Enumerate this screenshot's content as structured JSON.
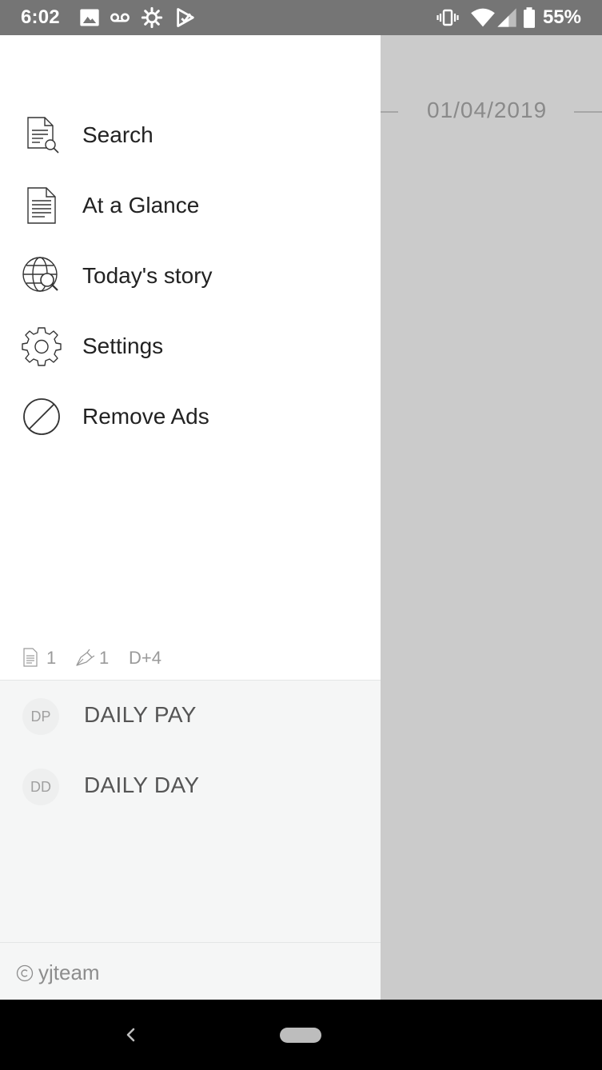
{
  "status_bar": {
    "time": "6:02",
    "battery": "55%"
  },
  "menu": {
    "items": [
      {
        "label": "Search",
        "icon": "document-search-icon"
      },
      {
        "label": "At a Glance",
        "icon": "document-icon"
      },
      {
        "label": "Today's story",
        "icon": "globe-search-icon"
      },
      {
        "label": "Settings",
        "icon": "gear-icon"
      },
      {
        "label": "Remove Ads",
        "icon": "prohibited-icon"
      }
    ]
  },
  "stats": {
    "entries": "1",
    "pen": "1",
    "dday": "D+4"
  },
  "accounts": [
    {
      "initials": "DP",
      "name": "DAILY PAY"
    },
    {
      "initials": "DD",
      "name": "DAILY DAY"
    }
  ],
  "footer": {
    "copyright": "yjteam"
  },
  "background": {
    "date": "01/04/2019"
  },
  "colors": {
    "statusbar": "#757575",
    "drawer": "#ffffff",
    "scrim": "#cbcbcb",
    "account_bg": "#f5f6f6"
  }
}
